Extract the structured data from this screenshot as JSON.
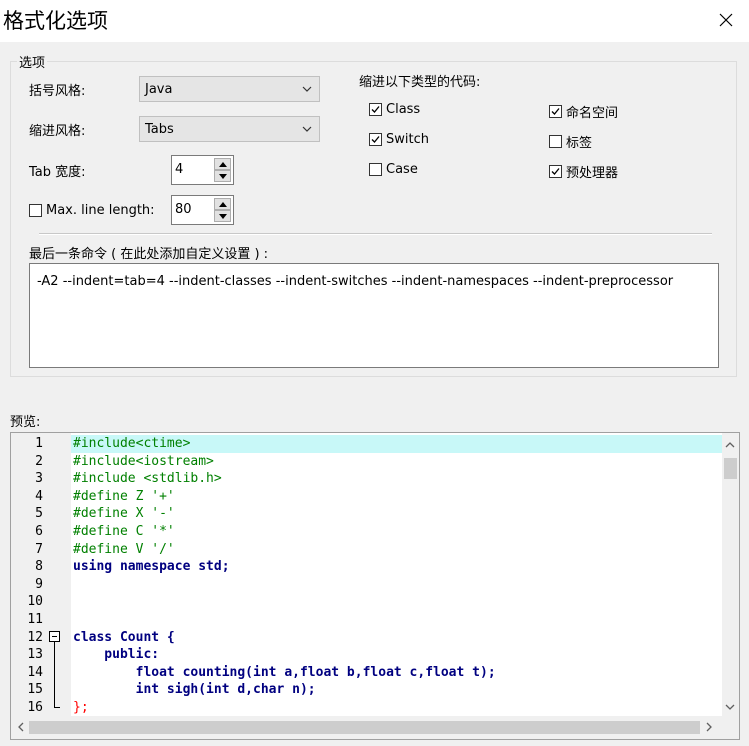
{
  "window": {
    "title": "格式化选项"
  },
  "options": {
    "legend": "选项",
    "bracket_style": {
      "label": "括号风格:",
      "value": "Java"
    },
    "indent_style": {
      "label": "缩进风格:",
      "value": "Tabs"
    },
    "tab_width": {
      "label": "Tab 宽度:",
      "value": "4"
    },
    "max_line_length": {
      "label": "Max. line length:",
      "value": "80",
      "checked": false
    },
    "indent_types": {
      "heading": "缩进以下类型的代码:",
      "items": [
        {
          "label": "Class",
          "checked": true
        },
        {
          "label": "Switch",
          "checked": true
        },
        {
          "label": "Case",
          "checked": false
        },
        {
          "label": "命名空间",
          "checked": true
        },
        {
          "label": "标签",
          "checked": false
        },
        {
          "label": "预处理器",
          "checked": true
        }
      ]
    },
    "command": {
      "label": "最后一条命令 ( 在此处添加自定义设置 ) :",
      "value": "-A2 --indent=tab=4 --indent-classes --indent-switches --indent-namespaces --indent-preprocessor"
    }
  },
  "preview": {
    "label": "预览:",
    "line_numbers": [
      "1",
      "2",
      "3",
      "4",
      "5",
      "6",
      "7",
      "8",
      "9",
      "10",
      "11",
      "12",
      "13",
      "14",
      "15",
      "16"
    ],
    "lines": [
      "#include<ctime>",
      "#include<iostream>",
      "#include <stdlib.h>",
      "#define Z '+'",
      "#define X '-'",
      "#define C '*'",
      "#define V '/'",
      "using namespace std;",
      "",
      "",
      "",
      "class Count {",
      "    public:",
      "        float counting(int a,float b,float c,float t);",
      "        int sigh(int d,char n);",
      "};"
    ]
  },
  "colors": {
    "preprocessor": "#008000",
    "keyword": "#000080",
    "punct": "#ff0000",
    "highlight": "#c8f8f8"
  }
}
